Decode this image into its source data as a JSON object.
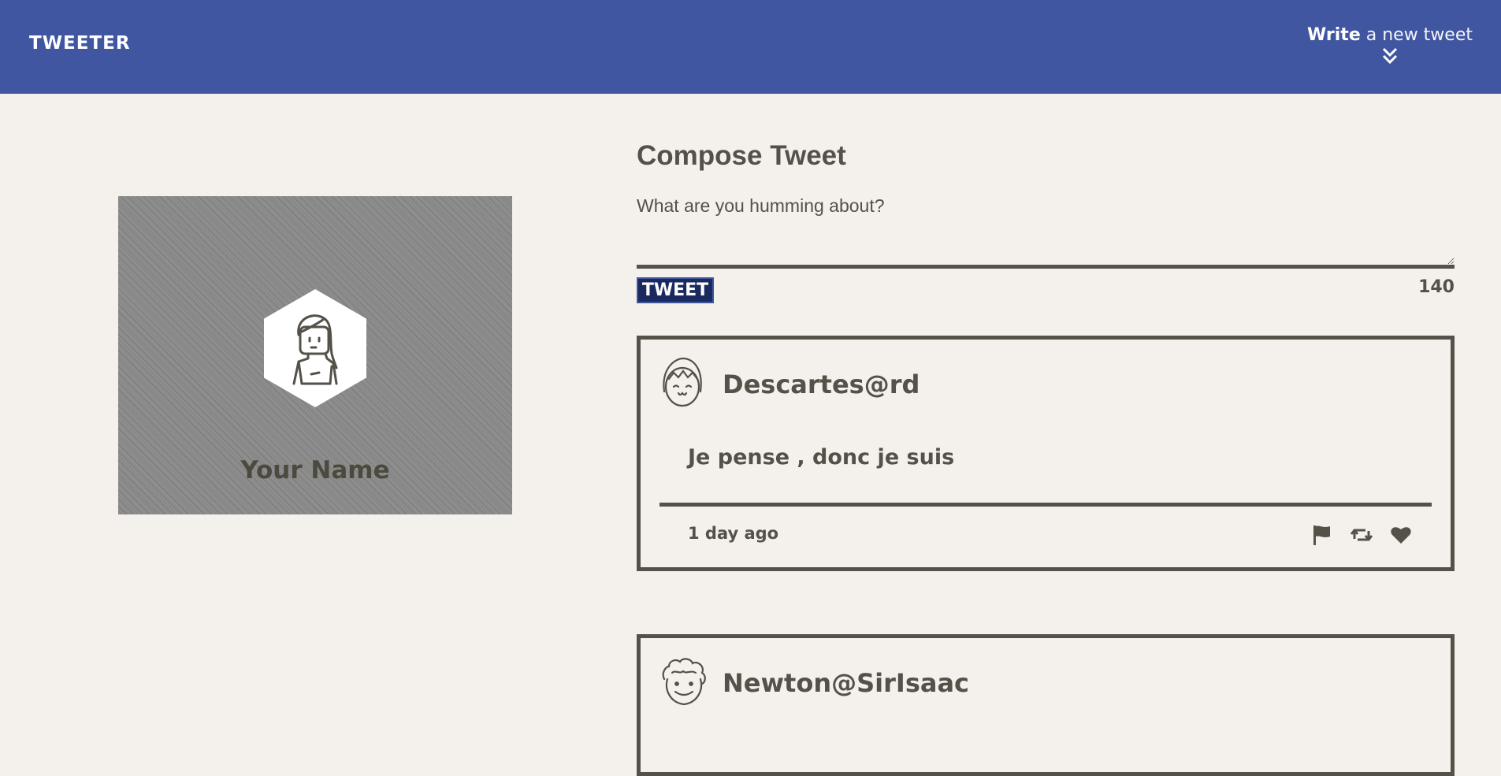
{
  "nav": {
    "brand": "TWEETER",
    "toggle_strong": "Write",
    "toggle_rest": " a new tweet",
    "toggle_icon": "double-chevron-down-icon"
  },
  "profile": {
    "name": "Your Name",
    "avatar_icon": "girl-avatar-icon"
  },
  "compose": {
    "title": "Compose Tweet",
    "placeholder": "What are you humming about?",
    "button_label": "TWEET",
    "counter": "140"
  },
  "tweets": [
    {
      "avatar_icon": "girl-face-avatar-icon",
      "handle": "Descartes@rd",
      "text": "Je pense , donc je suis",
      "time": "1 day ago",
      "actions": [
        "flag-icon",
        "retweet-icon",
        "heart-icon"
      ]
    },
    {
      "avatar_icon": "curly-hair-face-avatar-icon",
      "handle": "Newton@SirIsaac"
    }
  ],
  "colors": {
    "nav": "#4056a1",
    "background": "#f4f1ec",
    "text": "#545149",
    "tweet_button": "#1b2a5e"
  }
}
